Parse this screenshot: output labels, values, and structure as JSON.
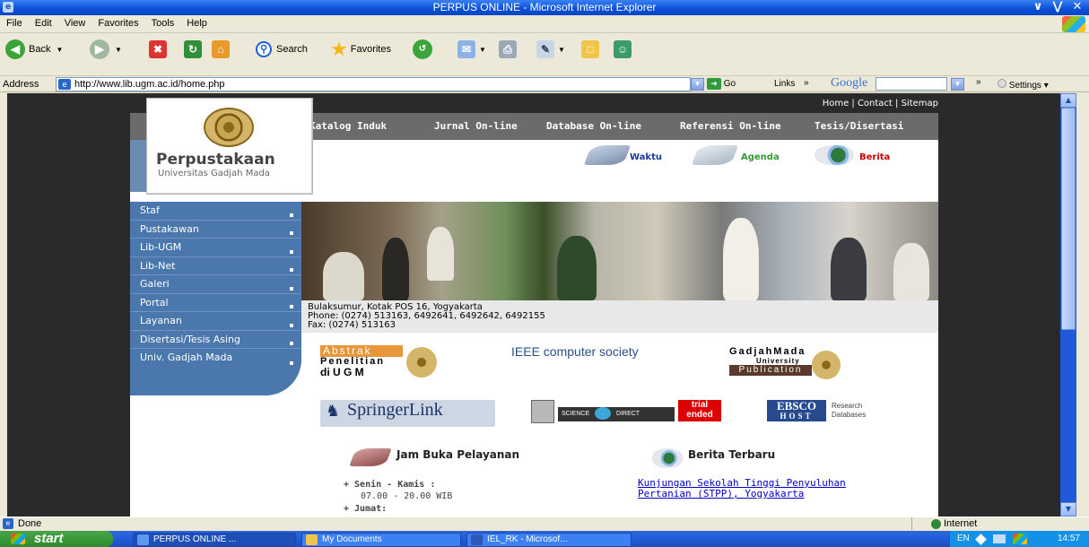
{
  "window": {
    "title": "PERPUS ONLINE - Microsoft Internet Explorer"
  },
  "menu": [
    "File",
    "Edit",
    "View",
    "Favorites",
    "Tools",
    "Help"
  ],
  "toolbar": {
    "back": "Back",
    "search": "Search",
    "favorites": "Favorites"
  },
  "address": {
    "label": "Address",
    "url": "http://www.lib.ugm.ac.id/home.php",
    "go": "Go",
    "links": "Links",
    "google": "Google",
    "settings": "Settings"
  },
  "site": {
    "top_links": "Home | Contact | Sitemap",
    "nav": [
      "Katalog Induk",
      "Jurnal On-line",
      "Database On-line",
      "Referensi On-line",
      "Tesis/Disertasi"
    ],
    "logo_title": "Perpustakaan",
    "logo_sub": "Universitas Gadjah Mada",
    "icons": [
      "Waktu",
      "Agenda",
      "Berita"
    ],
    "left_menu": [
      "Staf",
      "Pustakawan",
      "Lib-UGM",
      "Lib-Net",
      "Galeri",
      "Portal",
      "Layanan",
      "Disertasi/Tesis Asing",
      "Univ. Gadjah Mada"
    ],
    "address_lines": [
      "Bulaksumur, Kotak POS 16, Yogyakarta",
      "Phone: (0274) 513163, 6492641, 6492642, 6492155",
      "Fax: (0274) 513163"
    ],
    "partner_abstrak": [
      "Abstrak",
      "Penelitian",
      "di U G M"
    ],
    "partner_ieee": "IEEE computer society",
    "partner_gmup": [
      "GadjahMada",
      "University",
      "Publication"
    ],
    "partner_springer": "SpringerLink",
    "partner_sd": [
      "SCIENCE",
      "DIRECT",
      "trial",
      "ended"
    ],
    "partner_ebsco": [
      "EBSCO",
      "HOST",
      "Research",
      "Databases"
    ],
    "jam_title": "Jam Buka Pelayanan",
    "jam_day1": "+ Senin - Kamis :",
    "jam_time1": "07.00 - 20.00 WIB",
    "jam_day2": "+ Jumat:",
    "berita_title": "Berita Terbaru",
    "berita_link": "Kunjungan Sekolah Tinggi Penyuluhan Pertanian (STPP), Yogyakarta"
  },
  "status": {
    "text": "Done",
    "zone": "Internet"
  },
  "taskbar": {
    "start": "start",
    "tasks": [
      "PERPUS ONLINE ...",
      "My Documents",
      "IEL_RK - Microsof..."
    ],
    "lang": "EN",
    "time": "14:57"
  },
  "colors": {
    "accent": "#0a4fd6",
    "nav_gray": "#6b6b6b",
    "menu_blue": "#4a78ad",
    "berita_red": "#cc0000",
    "agenda_green": "#339933",
    "waktu_blue": "#1a3a9a"
  }
}
